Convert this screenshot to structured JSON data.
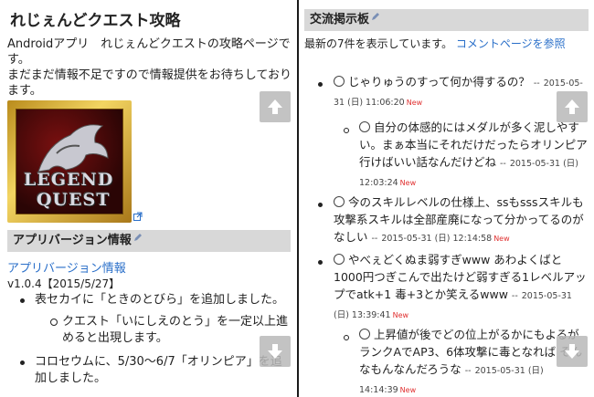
{
  "left": {
    "title": "れじぇんどクエスト攻略",
    "intro_line1": "Androidアプリ　れじぇんどクエストの攻略ページです。",
    "intro_line2": "まだまだ情報不足ですので情報提供をお待ちしております。",
    "logo_text_1": "LEGEND",
    "logo_text_2": "QUEST",
    "version_heading": "アプリバージョン情報",
    "app_link": "アプリバージョン情報",
    "version": "v1.0.4【2015/5/27】",
    "changes": [
      "表セカイに「ときのとびら」を追加しました。",
      "クエスト「いにしえのとう」を一定以上進めると出現します。",
      "コロセウムに、5/30〜6/7「オリンピア」を追加しました。"
    ]
  },
  "right": {
    "heading": "交流掲示板",
    "summary": "最新の7件を表示しています。",
    "comment_link": "コメントページを参照",
    "posts": [
      {
        "text": "じゃりゅうのすって何か得するの？",
        "date": "2015-05-31 (日) 11:06:20",
        "new": "New"
      },
      {
        "text": "自分の体感的にはメダルが多く泥しやすい。まぁ本当にそれだけだったらオリンピア行けばいい話なんだけどね",
        "date": "2015-05-31 (日) 12:03:24",
        "new": "New"
      },
      {
        "text": "今のスキルレベルの仕様上、ssもsssスキルも攻撃系スキルは全部産廃になって分かってるのがなしい",
        "date": "2015-05-31 (日) 12:14:58",
        "new": "New"
      },
      {
        "text": "やべぇどくぬま弱すぎwww あわよくばと1000円つぎこんで出たけど弱すぎる1レベルアップでatk+1 毒+3とか笑えるwww",
        "date": "2015-05-31 (日) 13:39:41",
        "new": "New"
      },
      {
        "text": "上昇値が後でどの位上がるかにもよるがランクAでAP3、6体攻撃に毒となれば そんなもんなんだろうな",
        "date": "2015-05-31 (日) 14:14:39",
        "new": "New"
      }
    ]
  },
  "separator": "--",
  "colors": {
    "accent": "#2a6fc9",
    "new": "#e03030",
    "heading_bg": "#d8d8d8"
  }
}
